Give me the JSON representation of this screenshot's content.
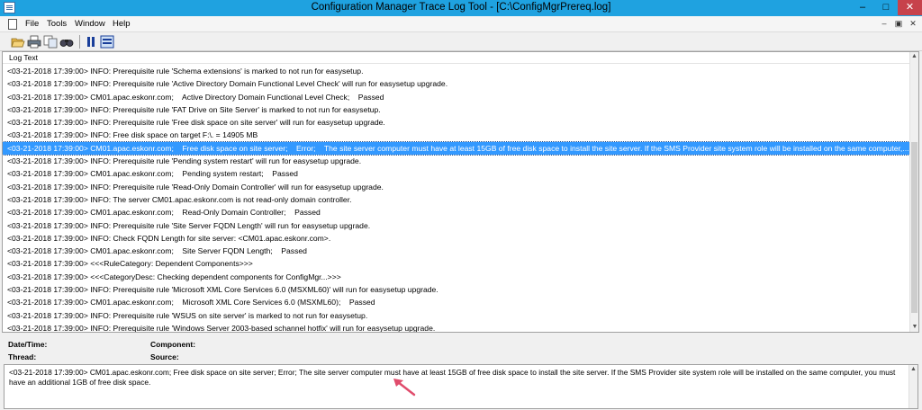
{
  "window": {
    "title": "Configuration Manager Trace Log Tool - [C:\\ConfigMgrPrereq.log]",
    "minimize": "–",
    "maximize": "□",
    "close": "✕"
  },
  "menu": {
    "file": "File",
    "tools": "Tools",
    "window": "Window",
    "help": "Help",
    "mdi_min": "–",
    "mdi_restore": "▣",
    "mdi_close": "✕"
  },
  "toolbar": {
    "icons": [
      "open-icon",
      "print-icon",
      "copy-icon",
      "find-icon",
      "pause-icon",
      "highlight-icon"
    ]
  },
  "log": {
    "header": "Log Text",
    "rows": [
      "<03-21-2018 17:39:00> INFO: Prerequisite rule 'Schema extensions' is marked to not run for easysetup.",
      "<03-21-2018 17:39:00> INFO: Prerequisite rule 'Active Directory Domain Functional Level Check' will run for easysetup upgrade.",
      "<03-21-2018 17:39:00> CM01.apac.eskonr.com;    Active Directory Domain Functional Level Check;    Passed",
      "<03-21-2018 17:39:00> INFO: Prerequisite rule 'FAT Drive on Site Server' is marked to not run for easysetup.",
      "<03-21-2018 17:39:00> INFO: Prerequisite rule 'Free disk space on site server' will run for easysetup upgrade.",
      "<03-21-2018 17:39:00> INFO: Free disk space on target F:\\. = 14905 MB",
      "<03-21-2018 17:39:00> CM01.apac.eskonr.com;    Free disk space on site server;    Error;    The site server computer must have at least 15GB of free disk space to install the site server. If the SMS Provider site system role will be installed on the same computer,...",
      "<03-21-2018 17:39:00> INFO: Prerequisite rule 'Pending system restart' will run for easysetup upgrade.",
      "<03-21-2018 17:39:00> CM01.apac.eskonr.com;    Pending system restart;    Passed",
      "<03-21-2018 17:39:00> INFO: Prerequisite rule 'Read-Only Domain Controller' will run for easysetup upgrade.",
      "<03-21-2018 17:39:00> INFO: The server CM01.apac.eskonr.com is not read-only domain controller.",
      "<03-21-2018 17:39:00> CM01.apac.eskonr.com;    Read-Only Domain Controller;    Passed",
      "<03-21-2018 17:39:00> INFO: Prerequisite rule 'Site Server FQDN Length' will run for easysetup upgrade.",
      "<03-21-2018 17:39:00> INFO: Check FQDN Length for site server: <CM01.apac.eskonr.com>.",
      "<03-21-2018 17:39:00> CM01.apac.eskonr.com;    Site Server FQDN Length;    Passed",
      "<03-21-2018 17:39:00> <<<RuleCategory: Dependent Components>>>",
      "<03-21-2018 17:39:00> <<<CategoryDesc: Checking dependent components for ConfigMgr...>>>",
      "<03-21-2018 17:39:00> INFO: Prerequisite rule 'Microsoft XML Core Services 6.0 (MSXML60)' will run for easysetup upgrade.",
      "<03-21-2018 17:39:00> CM01.apac.eskonr.com;    Microsoft XML Core Services 6.0 (MSXML60);    Passed",
      "<03-21-2018 17:39:00> INFO: Prerequisite rule 'WSUS on site server' is marked to not run for easysetup.",
      "<03-21-2018 17:39:00> INFO: Prerequisite rule 'Windows Server 2003-based schannel hotfix' will run for easysetup upgrade."
    ],
    "selected_index": 6
  },
  "details": {
    "datetime_label": "Date/Time:",
    "component_label": "Component:",
    "thread_label": "Thread:",
    "source_label": "Source:"
  },
  "message": {
    "text": "<03-21-2018 17:39:00> CM01.apac.eskonr.com;    Free disk space on site server;    Error;    The site server computer must have at least 15GB of free disk space to install the site server. If the SMS Provider site system role will be installed on the same computer, you must have an additional 1GB of free disk space."
  },
  "colors": {
    "titlebar": "#1fa2e0",
    "selection": "#3399ff",
    "annotation_arrow": "#e04c6c"
  }
}
